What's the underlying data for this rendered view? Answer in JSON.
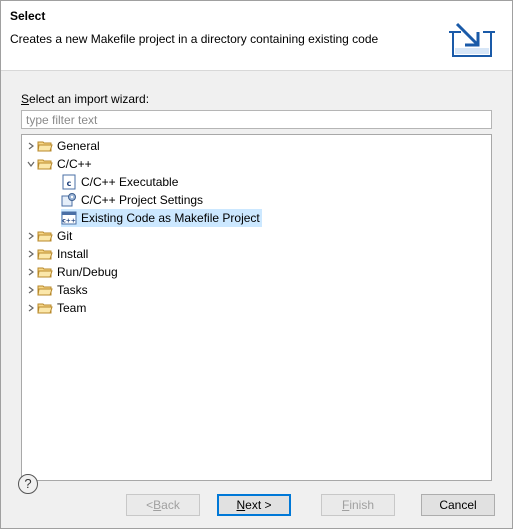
{
  "header": {
    "title": "Select",
    "description": "Creates a new Makefile project in a directory containing existing code"
  },
  "filter": {
    "label_mnemonic": "S",
    "label_rest": "elect an import wizard:",
    "placeholder": "type filter text",
    "value": ""
  },
  "tree": {
    "items": [
      {
        "label": "General",
        "type": "folder",
        "expanded": false
      },
      {
        "label": "C/C++",
        "type": "folder",
        "expanded": true
      },
      {
        "label": "C/C++ Executable",
        "type": "file",
        "icon": "c-executable-icon"
      },
      {
        "label": "C/C++ Project Settings",
        "type": "file",
        "icon": "project-settings-icon"
      },
      {
        "label": "Existing Code as Makefile Project",
        "type": "file",
        "icon": "makefile-project-icon",
        "selected": true
      },
      {
        "label": "Git",
        "type": "folder",
        "expanded": false
      },
      {
        "label": "Install",
        "type": "folder",
        "expanded": false
      },
      {
        "label": "Run/Debug",
        "type": "folder",
        "expanded": false
      },
      {
        "label": "Tasks",
        "type": "folder",
        "expanded": false
      },
      {
        "label": "Team",
        "type": "folder",
        "expanded": false
      }
    ],
    "selection_color": "#cce8ff"
  },
  "buttons": {
    "help": "?",
    "back_mnemonic": "B",
    "back_prefix": "< ",
    "back_rest": "ack",
    "next_mnemonic": "N",
    "next_rest": "ext >",
    "finish_mnemonic": "F",
    "finish_rest": "inish",
    "cancel": "Cancel"
  }
}
